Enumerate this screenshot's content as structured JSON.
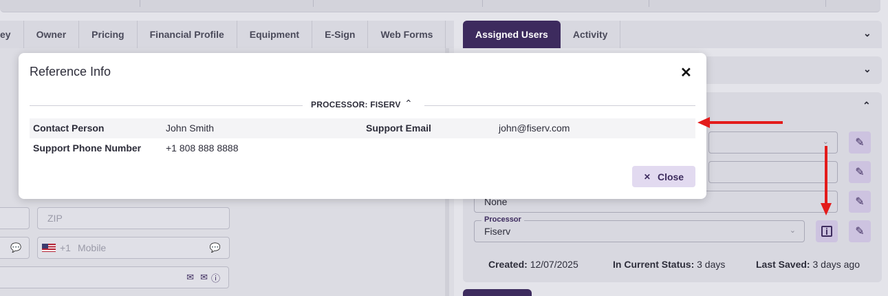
{
  "tabs_left": [
    "ey",
    "Owner",
    "Pricing",
    "Financial Profile",
    "Equipment",
    "E-Sign",
    "Web Forms"
  ],
  "tabs_right": [
    "Assigned Users",
    "Activity"
  ],
  "left_fields": {
    "zip_placeholder": "ZIP",
    "phone_prefix": "+1",
    "mobile_placeholder": "Mobile"
  },
  "right_fields": {
    "none_value": "None",
    "processor_label": "Processor",
    "processor_value": "Fiserv"
  },
  "status": {
    "created_label": "Created:",
    "created_value": "12/07/2025",
    "current_status_label": "In Current Status:",
    "current_status_value": "3 days",
    "last_saved_label": "Last Saved:",
    "last_saved_value": "3 days ago"
  },
  "modal": {
    "title": "Reference Info",
    "section": "PROCESSOR: FISERV",
    "rows": [
      {
        "label1": "Contact Person",
        "value1": "John Smith",
        "label2": "Support Email",
        "value2": "john@fiserv.com"
      },
      {
        "label1": "Support Phone Number",
        "value1": "+1 808 888 8888",
        "label2": "",
        "value2": ""
      }
    ],
    "close_label": "Close"
  },
  "colors": {
    "accent": "#3d2b5e",
    "annotation_arrow": "#e31b1b"
  }
}
